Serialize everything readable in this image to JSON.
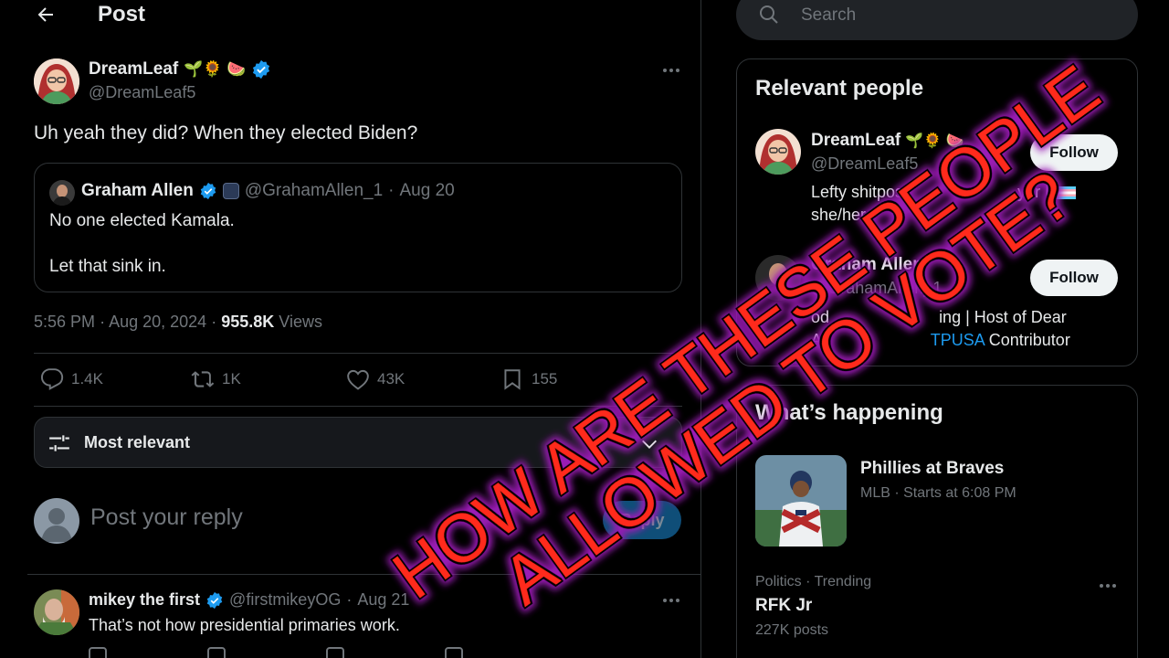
{
  "header": {
    "title": "Post"
  },
  "post": {
    "name": "DreamLeaf",
    "emoji": "🌱🌻 🍉",
    "handle": "@DreamLeaf5",
    "text": "Uh yeah they did? When they elected Biden?",
    "quote": {
      "name": "Graham Allen",
      "handle": "@GrahamAllen_1",
      "date": "Aug 20",
      "line1": "No one elected Kamala.",
      "line2": "Let that sink in."
    },
    "time": "5:56 PM",
    "date": "Aug 20, 2024",
    "views_count": "955.8K",
    "views_label": "Views",
    "replies": "1.4K",
    "reposts": "1K",
    "likes": "43K",
    "bookmarks": "155"
  },
  "sort": {
    "label": "Most relevant"
  },
  "composer": {
    "placeholder": "Post your reply",
    "button": "Reply"
  },
  "reply": {
    "name": "mikey the first",
    "handle": "@firstmikeyOG",
    "date": "Aug 21",
    "text": "That’s not how presidential primaries work."
  },
  "search": {
    "placeholder": "Search"
  },
  "relevant": {
    "title": "Relevant people",
    "people": [
      {
        "name": "DreamLeaf",
        "emoji": "🌱🌻 🍉",
        "handle": "@DreamLeaf5",
        "bio_line1": "Lefty shitpost",
        "bio_line1b": "yer |",
        "bio_line2": "she/her",
        "button": "Follow"
      },
      {
        "name": "Graham Allen",
        "handle": "@GrahamAllen_1",
        "bio_line1": "od",
        "bio_line1b": "ing | Host of Dear",
        "bio_line2a": "A",
        "bio_link": "TPUSA",
        "bio_line2b": "Contributor",
        "button": "Follow"
      }
    ]
  },
  "happening": {
    "title": "What’s happening",
    "items": [
      {
        "title": "Phillies at Braves",
        "meta": "MLB · Starts at 6:08 PM"
      },
      {
        "meta": "Politics · Trending",
        "title": "RFK Jr",
        "count": "227K posts"
      }
    ]
  },
  "overlay": {
    "line1": "HOW ARE THESE PEOPLE",
    "line2": "ALLOWED TO VOTE?"
  },
  "colors": {
    "accent": "#1d9bf0",
    "background": "#000000",
    "overlay_text": "#ff2a1a",
    "overlay_glow": "#9b1bb5"
  }
}
